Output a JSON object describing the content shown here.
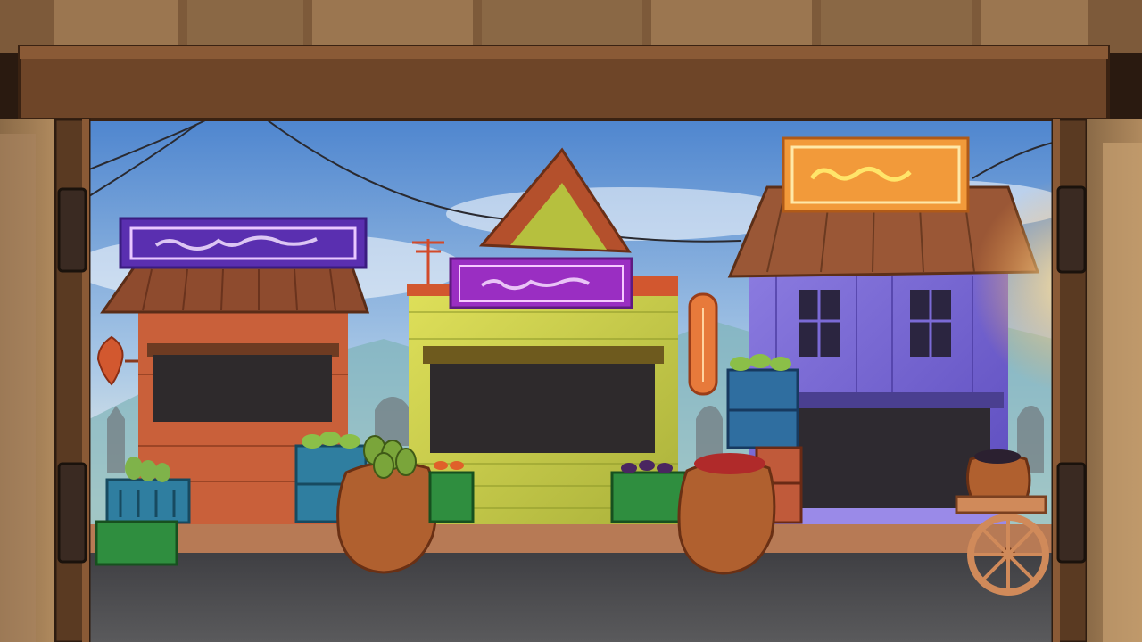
{
  "scene": {
    "description_label": "",
    "colors": {
      "sky_top": "#5f98d8",
      "sky_bottom": "#f4f1e6",
      "wall_brown": "#7a4e2c",
      "beam_brown": "#6e4528",
      "stall_red": "#c9603a",
      "stall_yellow": "#d4d84a",
      "house_purple": "#7b6ad6",
      "neon_magenta": "#c845e6",
      "neon_orange": "#f3a23a",
      "ground": "#4b4b4e"
    }
  },
  "signs": [
    {
      "id": "sign-left",
      "style": "neon-purple"
    },
    {
      "id": "sign-center",
      "style": "neon-magenta"
    },
    {
      "id": "sign-right",
      "style": "neon-orange"
    },
    {
      "id": "sign-vertical",
      "style": "lantern-orange"
    }
  ],
  "icons": {
    "cart_wheel": "cart-wheel-icon",
    "utility_pole": "utility-pole-icon",
    "door_hinge": "hinge-icon"
  }
}
